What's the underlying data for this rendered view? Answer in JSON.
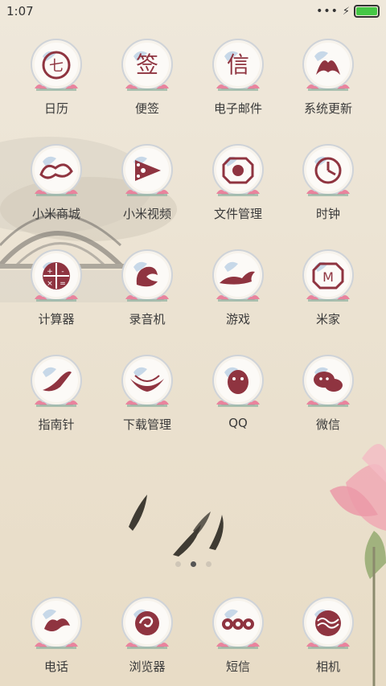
{
  "status_bar": {
    "time": "1:07",
    "signal_dots": "•••",
    "bolt": "⚡",
    "battery_color": "#45c745"
  },
  "theme": {
    "accent": "#8f3440",
    "lotus": "#e9839d"
  },
  "apps": [
    {
      "label": "日历",
      "glyph": "七",
      "icon_name": "calendar-icon"
    },
    {
      "label": "便签",
      "glyph": "签",
      "icon_name": "notes-icon"
    },
    {
      "label": "电子邮件",
      "glyph": "信",
      "icon_name": "email-icon"
    },
    {
      "label": "系统更新",
      "glyph": "",
      "icon_name": "system-update-icon"
    },
    {
      "label": "小米商城",
      "glyph": "",
      "icon_name": "mi-store-icon"
    },
    {
      "label": "小米视频",
      "glyph": "",
      "icon_name": "mi-video-icon"
    },
    {
      "label": "文件管理",
      "glyph": "",
      "icon_name": "file-manager-icon"
    },
    {
      "label": "时钟",
      "glyph": "",
      "icon_name": "clock-icon"
    },
    {
      "label": "计算器",
      "glyph": "",
      "icon_name": "calculator-icon"
    },
    {
      "label": "录音机",
      "glyph": "",
      "icon_name": "recorder-icon"
    },
    {
      "label": "游戏",
      "glyph": "",
      "icon_name": "game-dragon-icon"
    },
    {
      "label": "米家",
      "glyph": "",
      "icon_name": "mijia-icon"
    },
    {
      "label": "指南针",
      "glyph": "",
      "icon_name": "compass-icon"
    },
    {
      "label": "下载管理",
      "glyph": "",
      "icon_name": "download-manager-icon"
    },
    {
      "label": "QQ",
      "glyph": "",
      "icon_name": "qq-icon"
    },
    {
      "label": "微信",
      "glyph": "",
      "icon_name": "wechat-icon"
    }
  ],
  "dock": [
    {
      "label": "电话",
      "icon_name": "phone-cloud-icon"
    },
    {
      "label": "浏览器",
      "icon_name": "browser-swirl-icon"
    },
    {
      "label": "短信",
      "icon_name": "sms-swirl-icon"
    },
    {
      "label": "相机",
      "icon_name": "camera-icon"
    }
  ],
  "pages": {
    "count": 3,
    "active_index": 1
  }
}
